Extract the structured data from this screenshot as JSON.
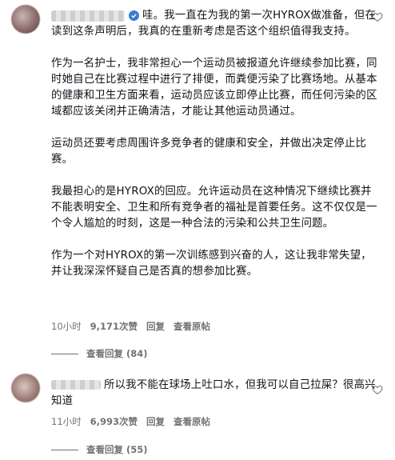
{
  "comments": [
    {
      "paragraphs": [
        "哇。我一直在为我的第一次HYROX做准备，但在读到这条声明后，我真的在重新考虑是否这个组织值得我支持。",
        "作为一名护士，我非常担心一个运动员被报道允许继续参加比赛，同时她自己在比赛过程中进行了排便，而粪便污染了比赛场地。从基本的健康和卫生方面来看，运动员应该立即停止比赛，而任何污染的区域都应该关闭并正确清洁，才能让其他运动员通过。",
        "运动员还要考虑周围许多竞争者的健康和安全，并做出决定停止比赛。",
        "我最担心的是HYROX的回应。允许运动员在这种情况下继续比赛并不能表明安全、卫生和所有竞争者的福祉是首要任务。这不仅仅是一个令人尴尬的时刻，这是一种合法的污染和公共卫生问题。",
        "作为一个对HYROX的第一次训练感到兴奋的人，这让我非常失望，并让我深深怀疑自己是否真的想参加比赛。"
      ],
      "time": "10小时",
      "likes": "9,171次赞",
      "reply_label": "回复",
      "view_original_label": "查看原帖",
      "view_replies": "查看回复 (84)"
    },
    {
      "paragraphs": [
        "所以我不能在球场上吐口水，但我可以自己拉屎？很高兴知道"
      ],
      "time": "11小时",
      "likes": "6,993次赞",
      "reply_label": "回复",
      "view_original_label": "查看原帖",
      "view_replies": "查看回复 (55)"
    }
  ],
  "icons": [
    "verified-badge-icon",
    "heart-icon"
  ],
  "colors": {
    "text": "#0f1419",
    "meta": "#737373",
    "verified": "#3a7bd5"
  }
}
